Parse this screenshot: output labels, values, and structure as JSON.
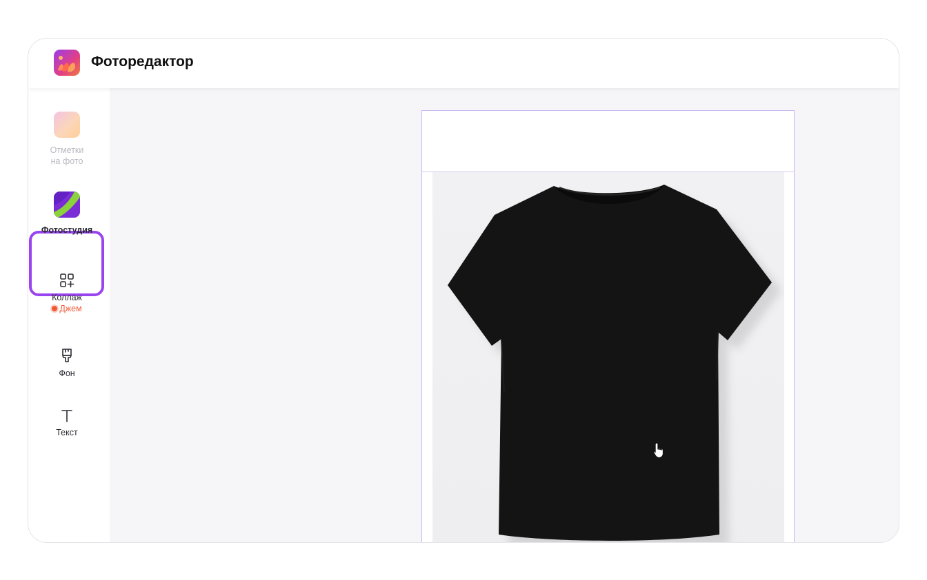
{
  "app": {
    "title": "Фоторедактор"
  },
  "sidebar": {
    "items": [
      {
        "label_line1": "Отметки",
        "label_line2": "на фото",
        "icon": "photo-marks-app-icon",
        "state": "disabled"
      },
      {
        "label": "Фотостудия",
        "icon": "photo-studio-app-icon",
        "state": "active"
      },
      {
        "label": "Коллаж",
        "badge": "Джем",
        "icon": "collage-icon"
      },
      {
        "label": "Фон",
        "icon": "brush-icon"
      },
      {
        "label": "Текст",
        "icon": "text-icon"
      }
    ]
  },
  "canvas": {
    "image": "black t-shirt back view",
    "cursor": "hand-pointer-icon"
  },
  "colors": {
    "accent": "#9a44ef",
    "badge": "#f15a35",
    "frame": "#c9b6ee"
  }
}
